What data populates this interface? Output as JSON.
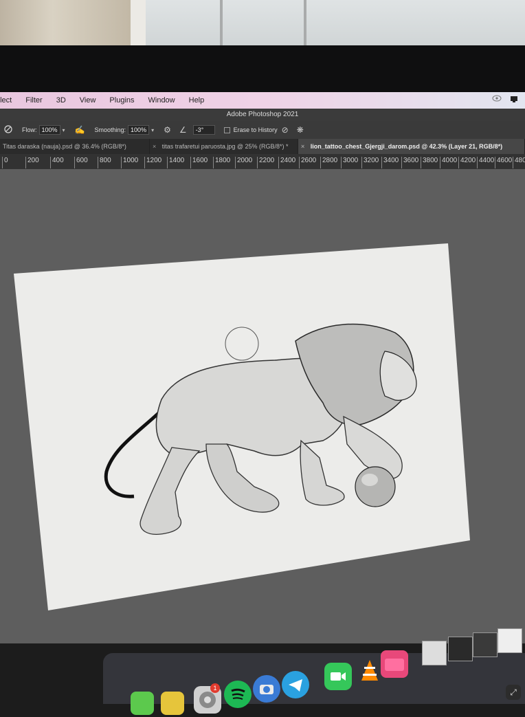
{
  "menubar": {
    "items": [
      "elect",
      "Filter",
      "3D",
      "View",
      "Plugins",
      "Window",
      "Help"
    ]
  },
  "app": {
    "title": "Adobe Photoshop 2021"
  },
  "options": {
    "flow_label": "Flow:",
    "flow_value": "100%",
    "smoothing_label": "Smoothing:",
    "smoothing_value": "100%",
    "angle_value": "-3°",
    "erase_history_label": "Erase to History"
  },
  "tabs": [
    {
      "label": "Titas daraska (nauja).psd @ 36.4% (RGB/8*)"
    },
    {
      "label": "titas trafaretui paruosta.jpg @ 25% (RGB/8*) *"
    },
    {
      "label": "lion_tattoo_chest_Gjergji_darom.psd @ 42.3% (Layer 21, RGB/8*)"
    }
  ],
  "ruler": {
    "ticks": [
      "0",
      "200",
      "400",
      "600",
      "800",
      "1000",
      "1200",
      "1400",
      "1600",
      "1800",
      "2000",
      "2200",
      "2400",
      "2600",
      "2800",
      "3000",
      "3200",
      "3400",
      "3600",
      "3800",
      "4000",
      "4200",
      "4400",
      "4600",
      "480"
    ]
  },
  "dock": {
    "badge_count": "1",
    "apps": [
      "spotify-icon",
      "camera-icon",
      "telegram-icon",
      "facetime-icon",
      "vlc-icon",
      "cleanmymac-icon"
    ]
  },
  "colors": {
    "workspace": "#5e5e5e",
    "canvas": "#ededed",
    "active_tab": "#474747",
    "menubar": "#efd2e6"
  }
}
